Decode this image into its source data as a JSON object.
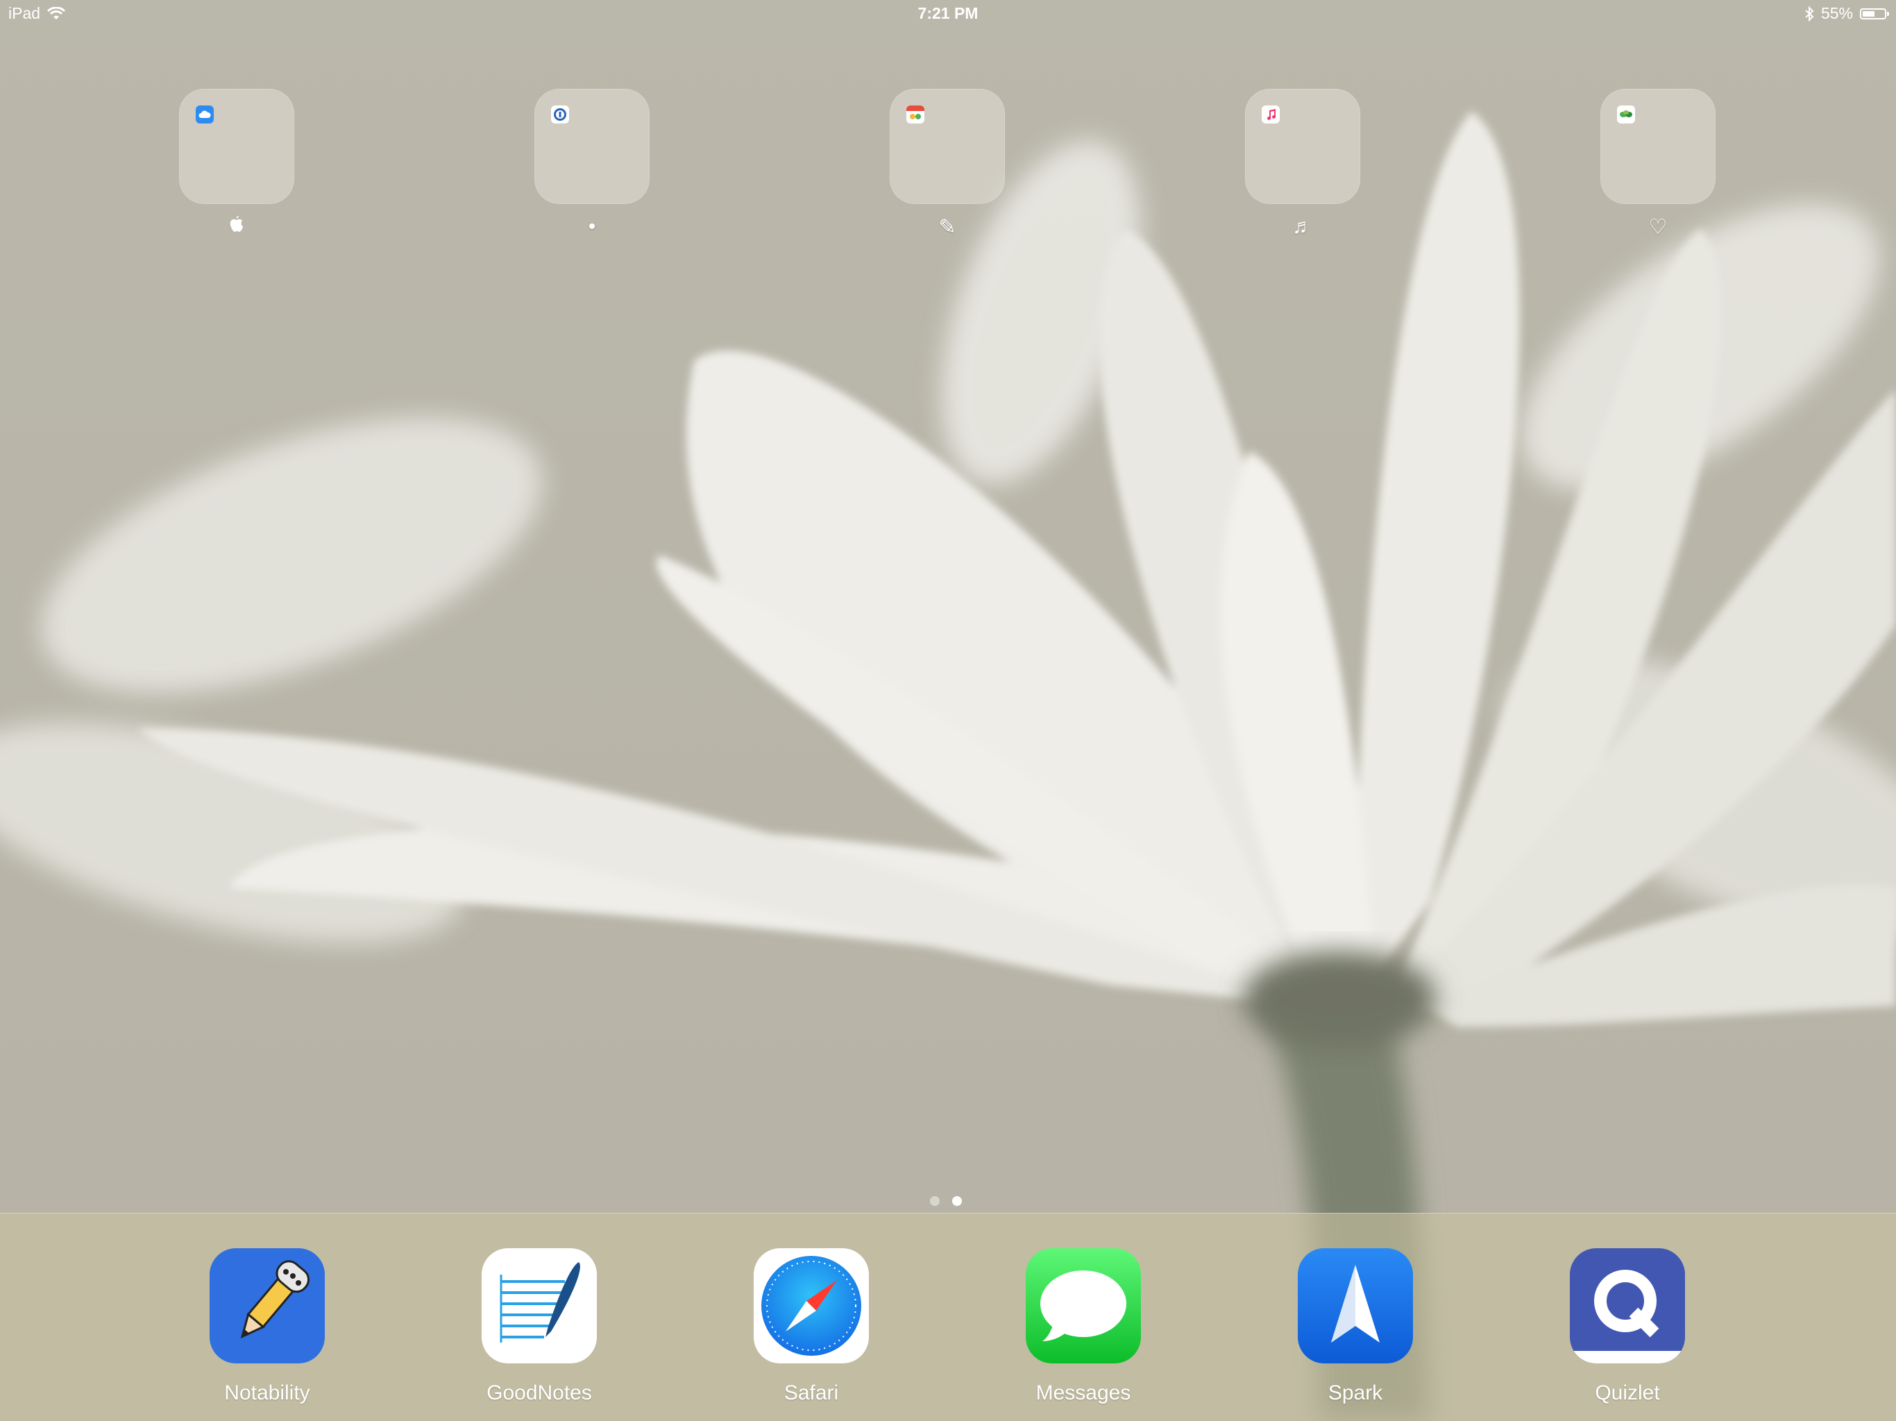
{
  "status_bar": {
    "device": "iPad",
    "time": "7:21 PM",
    "battery_percent": "55%",
    "battery_level": 0.55,
    "icons": [
      "wifi-icon",
      "bluetooth-icon",
      "battery-icon"
    ]
  },
  "home": {
    "folders": [
      {
        "name": "",
        "label_glyph": "",
        "label_icon": "apple-logo-icon",
        "mini_icon": "icloud-drive-icon",
        "mini_color": "#2d8cf0"
      },
      {
        "name": "•",
        "mini_icon": "1password-icon",
        "mini_color": "#2a62b8"
      },
      {
        "name": "✎",
        "mini_icon": "calendar-app-icon",
        "mini_color": "#ffffff"
      },
      {
        "name": "♬",
        "mini_icon": "music-app-icon",
        "mini_color": "#ffffff"
      },
      {
        "name": "♡",
        "mini_icon": "health-app-icon",
        "mini_color": "#ffffff"
      }
    ],
    "page_indicator": {
      "count": 2,
      "current": 2
    }
  },
  "dock": {
    "apps": [
      {
        "label": "Notability",
        "icon": "notability-icon",
        "color": "#2f6fe0"
      },
      {
        "label": "GoodNotes",
        "icon": "goodnotes-icon",
        "color": "#ffffff"
      },
      {
        "label": "Safari",
        "icon": "safari-icon",
        "color": "#ffffff"
      },
      {
        "label": "Messages",
        "icon": "messages-icon",
        "color": "#34c759"
      },
      {
        "label": "Spark",
        "icon": "spark-icon",
        "color": "#1468e0"
      },
      {
        "label": "Quizlet",
        "icon": "quizlet-icon",
        "color": "#4257b2"
      }
    ]
  }
}
